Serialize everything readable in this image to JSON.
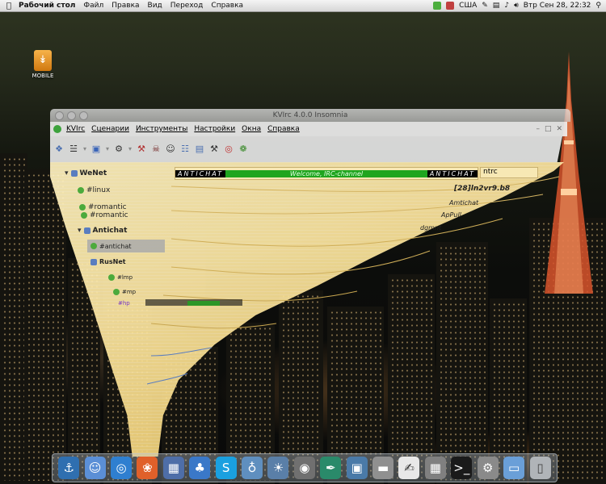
{
  "top_menu": {
    "app_name": "Рабочий стол",
    "items": [
      "Файл",
      "Правка",
      "Вид",
      "Переход",
      "Справка"
    ],
    "keyboard_layout": "США",
    "clock": "Втр Сен 28, 22:32"
  },
  "desktop": {
    "icon_label": "MOBILE"
  },
  "window": {
    "title": "KVIrc 4.0.0 Insomnia",
    "menu": [
      "KVIrc",
      "Сценарии",
      "Инструменты",
      "Настройки",
      "Окна",
      "Справка"
    ],
    "toolbar_icons": [
      "servers-icon",
      "microphone-icon",
      "editor-icon",
      "options-icon",
      "gears-icon",
      "tools-icon",
      "bot-icon",
      "person-icon",
      "book-icon",
      "document-icon",
      "wrench-icon",
      "lifebuoy-icon",
      "bug-icon"
    ]
  },
  "tree": {
    "networks": [
      {
        "name": "WeNet",
        "channels": [
          "#linux",
          "#romantic",
          "#romantic"
        ]
      },
      {
        "name": "Antichat",
        "channels": [
          "#antichat"
        ]
      },
      {
        "name": "RusNet",
        "channels": [
          "#lmp",
          "#mp",
          "#hp"
        ]
      }
    ]
  },
  "channel": {
    "topic_brand": "ANTICHAT",
    "topic_text": "Welcome, IRC-channel",
    "name": "ntrc"
  },
  "users": [
    "[28]ln2vr9.b8",
    "Amtichat",
    "ApPull",
    "dgmnt"
  ],
  "colors": {
    "window_bg": "#fde7a2",
    "topic_green": "#1fa51f",
    "selection": "#aaaaaa"
  },
  "dock": [
    "anchor-icon",
    "finder-icon",
    "browser-icon",
    "firefox-icon",
    "preview-icon",
    "messenger-icon",
    "skype-icon",
    "network-icon",
    "iphoto-icon",
    "camera-icon",
    "feather-icon",
    "photo-icon",
    "drive-icon",
    "textedit-icon",
    "calculator-icon",
    "terminal-icon",
    "settings-icon",
    "folder-icon",
    "trash-icon"
  ]
}
